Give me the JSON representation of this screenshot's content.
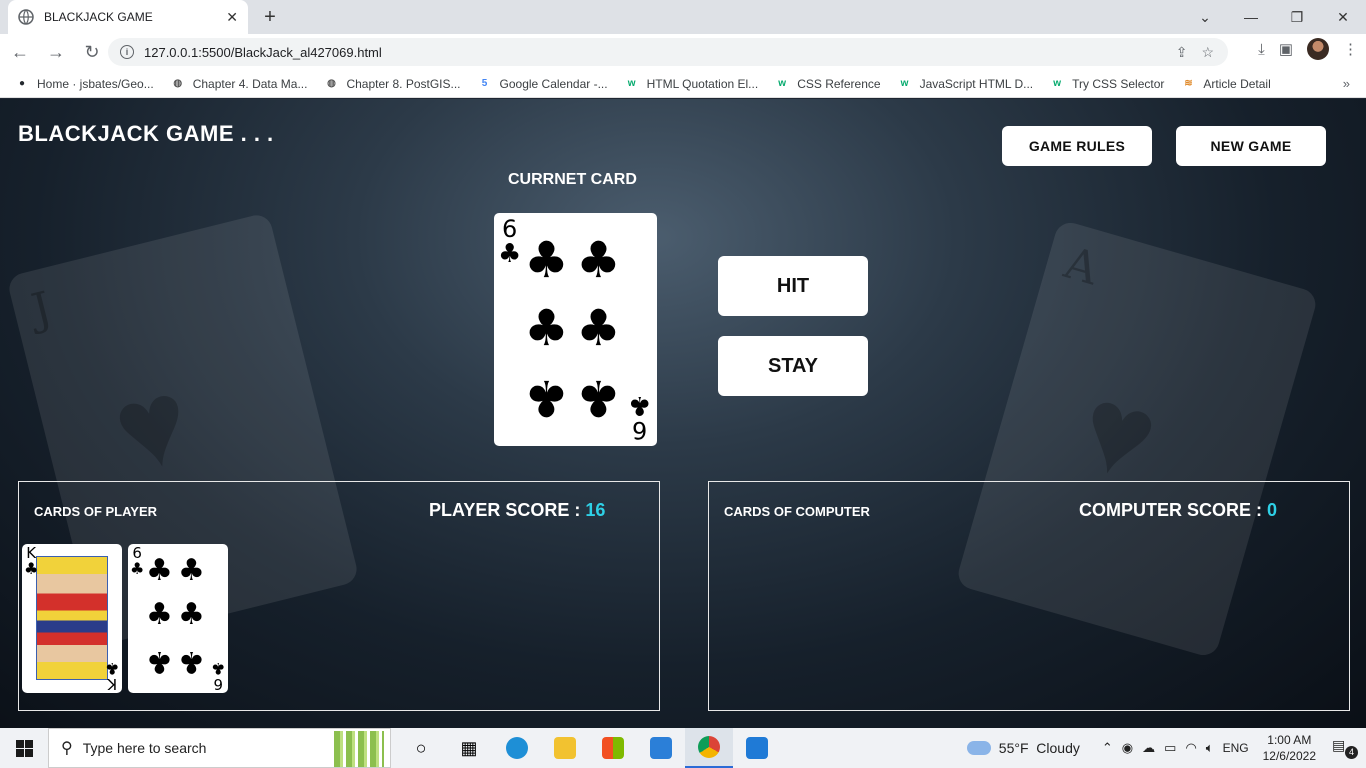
{
  "browser": {
    "tab_title": "BLACKJACK GAME",
    "tab_close": "✕",
    "new_tab": "+",
    "url": "127.0.0.1:5500/BlackJack_al427069.html",
    "window_controls": {
      "dropdown": "⌄",
      "minimize": "—",
      "restore": "❐",
      "close": "✕"
    },
    "nav": {
      "back": "←",
      "forward": "→",
      "reload": "↻"
    },
    "bookmarks": [
      {
        "label": "Home · jsbates/Geo...",
        "icon": "github-icon",
        "icon_color": "#24292f"
      },
      {
        "label": "Chapter 4. Data Ma...",
        "icon": "globe-icon",
        "icon_color": "#555555"
      },
      {
        "label": "Chapter 8. PostGIS...",
        "icon": "globe-icon",
        "icon_color": "#555555"
      },
      {
        "label": "Google Calendar -...",
        "icon": "calendar-icon",
        "icon_color": "#4285f4"
      },
      {
        "label": "HTML Quotation El...",
        "icon": "w3schools-icon",
        "icon_color": "#04aa6d"
      },
      {
        "label": "CSS Reference",
        "icon": "w3schools-icon",
        "icon_color": "#04aa6d"
      },
      {
        "label": "JavaScript HTML D...",
        "icon": "w3schools-icon",
        "icon_color": "#04aa6d"
      },
      {
        "label": "Try CSS Selector",
        "icon": "w3schools-icon",
        "icon_color": "#04aa6d"
      },
      {
        "label": "Article Detail",
        "icon": "article-icon",
        "icon_color": "#e08a2a"
      }
    ],
    "bookmarks_more": "»"
  },
  "game": {
    "title": "BLACKJACK GAME . . .",
    "rules_button": "GAME RULES",
    "new_game_button": "NEW GAME",
    "current_card_label": "CURRNET CARD",
    "current_card": {
      "rank": "6",
      "suit": "♣"
    },
    "hit_button": "HIT",
    "stay_button": "STAY",
    "player": {
      "label": "CARDS OF PLAYER",
      "score_label": "PLAYER SCORE : ",
      "score": "16",
      "cards": [
        {
          "rank": "K",
          "suit": "♣"
        },
        {
          "rank": "6",
          "suit": "♣"
        }
      ]
    },
    "computer": {
      "label": "CARDS OF COMPUTER",
      "score_label": "COMPUTER SCORE : ",
      "score": "0"
    },
    "accent_color": "#2ed0e6",
    "background_cards": {
      "left_rank": "J",
      "right_rank": "A"
    }
  },
  "taskbar": {
    "search_placeholder": "Type here to search",
    "weather_temp": "55°F",
    "weather_text": "Cloudy",
    "language": "ENG",
    "time": "1:00 AM",
    "date": "12/6/2022",
    "notification_count": "4"
  }
}
